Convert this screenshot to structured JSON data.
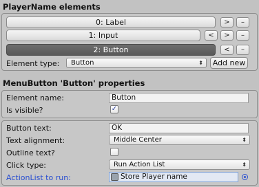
{
  "elements_section": {
    "title": "PlayerName elements",
    "items": [
      {
        "label": "0: Label",
        "buttons": [
          ">",
          "–"
        ],
        "selected": false
      },
      {
        "label": "1: Input",
        "buttons": [
          "<",
          ">",
          "–"
        ],
        "selected": false
      },
      {
        "label": "2: Button",
        "buttons": [
          "<",
          "–"
        ],
        "selected": true
      }
    ],
    "element_type_label": "Element type:",
    "element_type_value": "Button",
    "add_new_label": "Add new"
  },
  "properties_section": {
    "title": "MenuButton 'Button' properties",
    "element_name_label": "Element name:",
    "element_name_value": "Button",
    "is_visible_label": "Is visible?",
    "is_visible_checked": true,
    "button_text_label": "Button text:",
    "button_text_value": "OK",
    "text_alignment_label": "Text alignment:",
    "text_alignment_value": "Middle Center",
    "outline_text_label": "Outline text?",
    "outline_text_checked": false,
    "click_type_label": "Click type:",
    "click_type_value": "Run Action List",
    "actionlist_label": "ActionList to run:",
    "actionlist_value": "Store Player name"
  },
  "icons": {
    "dropdown_arrow": "updown-arrow-icon",
    "checkmark": "checkmark-icon",
    "object_picker": "object-picker-icon",
    "target": "target-circle-icon"
  },
  "colors": {
    "background": "#c2c2c2",
    "selected_item": "#5f5f5f",
    "link_label": "#2a4fd1"
  }
}
